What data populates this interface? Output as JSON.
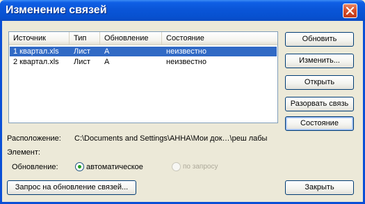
{
  "window": {
    "title": "Изменение связей"
  },
  "links": {
    "columns": [
      "Источник",
      "Тип",
      "Обновление",
      "Состояние"
    ],
    "rows": [
      [
        "1 квартал.xls",
        "Лист",
        "А",
        "неизвестно"
      ],
      [
        "2 квартал.xls",
        "Лист",
        "А",
        "неизвестно"
      ]
    ]
  },
  "buttons": {
    "update": "Обновить",
    "change": "Изменить...",
    "open": "Открыть",
    "break": "Разорвать связь",
    "status": "Состояние",
    "startup_prompt": "Запрос на обновление связей...",
    "close": "Закрыть"
  },
  "details": {
    "location_label": "Расположение:",
    "location_value": "C:\\Documents and Settings\\АННА\\Мои док…\\реш лабы",
    "element_label": "Элемент:",
    "update_label": "Обновление:",
    "update_auto": "автоматическое",
    "update_manual": "по запросу"
  }
}
